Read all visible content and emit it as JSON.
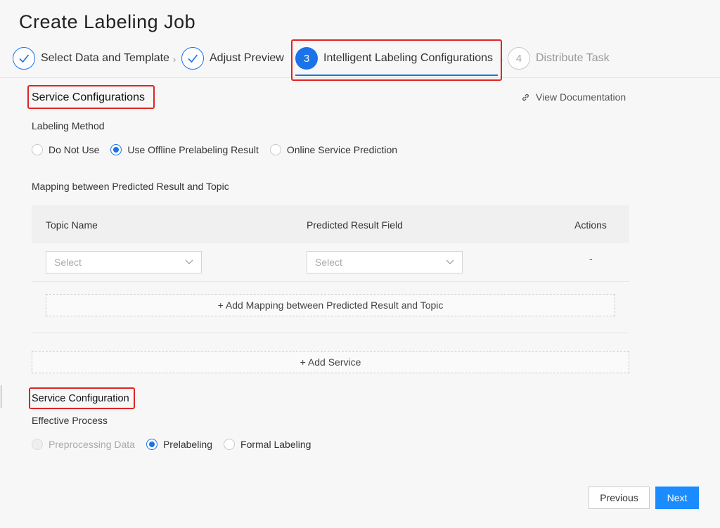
{
  "page": {
    "title": "Create Labeling Job"
  },
  "steps": [
    {
      "label": "Select Data and Template",
      "status": "done"
    },
    {
      "label": "Adjust Preview",
      "status": "done"
    },
    {
      "number": "3",
      "label": "Intelligent Labeling Configurations",
      "status": "active"
    },
    {
      "number": "4",
      "label": "Distribute Task",
      "status": "pending"
    }
  ],
  "service_config": {
    "title": "Service Configurations",
    "doc_link": "View Documentation",
    "labeling_method": {
      "label": "Labeling Method",
      "options": [
        "Do Not Use",
        "Use Offline Prelabeling Result",
        "Online Service Prediction"
      ],
      "selected": "Use Offline Prelabeling Result"
    },
    "mapping": {
      "label": "Mapping between Predicted Result and Topic",
      "columns": [
        "Topic Name",
        "Predicted Result Field",
        "Actions"
      ],
      "row": {
        "topic_placeholder": "Select",
        "field_placeholder": "Select",
        "action": "-"
      },
      "add_mapping_label": "+ Add Mapping between Predicted Result and Topic"
    },
    "add_service_label": "+ Add Service"
  },
  "service_configuration": {
    "title": "Service Configuration",
    "effective_process": {
      "label": "Effective Process",
      "options": [
        "Preprocessing Data",
        "Prelabeling",
        "Formal Labeling"
      ],
      "selected": "Prelabeling",
      "disabled": [
        "Preprocessing Data"
      ]
    }
  },
  "footer": {
    "previous_label": "Previous",
    "next_label": "Next"
  },
  "colors": {
    "primary": "#1a73e8",
    "highlight": "#e02424",
    "button_primary": "#1a8cff"
  }
}
